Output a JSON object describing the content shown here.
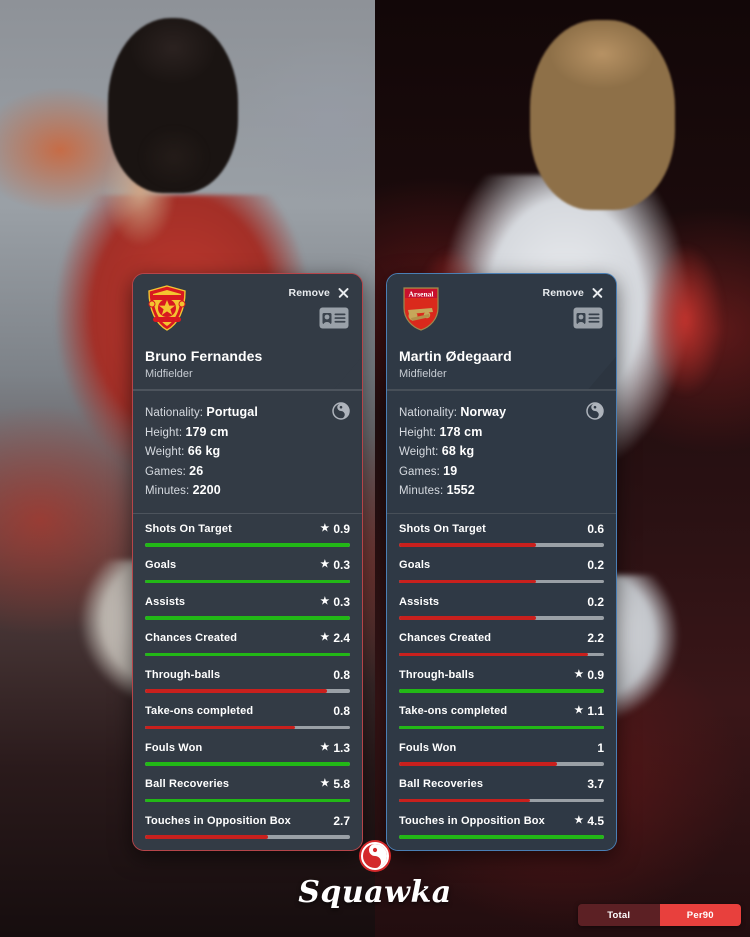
{
  "brand": {
    "name": "Squawka",
    "mark_icon": "squawka-yin-yang-icon"
  },
  "mode_toggle": {
    "options": [
      "Total",
      "Per90"
    ],
    "selected": "Per90",
    "active_color": "#e8403d",
    "inactive_color": "#5c2024"
  },
  "colors": {
    "win_bar": "#22b816",
    "lose_bar": "#c9201d",
    "track": "#9aa0a6",
    "card_bg": "#333b45",
    "left_border": "#b6454a",
    "right_border": "#4a7fb5"
  },
  "cards": [
    {
      "side": "left",
      "club": "Manchester United",
      "crest_icon": "manchester-united-crest-icon",
      "remove_label": "Remove",
      "close_icon": "close-icon",
      "idcard_icon": "player-id-card-icon",
      "name": "Bruno Fernandes",
      "position": "Midfielder",
      "info_icon": "squawka-yin-yang-icon",
      "bio": [
        {
          "label": "Nationality:",
          "value": "Portugal"
        },
        {
          "label": "Height:",
          "value": "179 cm"
        },
        {
          "label": "Weight:",
          "value": "66 kg"
        },
        {
          "label": "Games:",
          "value": "26"
        },
        {
          "label": "Minutes:",
          "value": "2200"
        }
      ],
      "stats": [
        {
          "label": "Shots On Target",
          "value": "0.9",
          "winner": true,
          "bar_pct": 100
        },
        {
          "label": "Goals",
          "value": "0.3",
          "winner": true,
          "bar_pct": 100
        },
        {
          "label": "Assists",
          "value": "0.3",
          "winner": true,
          "bar_pct": 100
        },
        {
          "label": "Chances Created",
          "value": "2.4",
          "winner": true,
          "bar_pct": 100
        },
        {
          "label": "Through-balls",
          "value": "0.8",
          "winner": false,
          "bar_pct": 89
        },
        {
          "label": "Take-ons completed",
          "value": "0.8",
          "winner": false,
          "bar_pct": 73
        },
        {
          "label": "Fouls Won",
          "value": "1.3",
          "winner": true,
          "bar_pct": 100
        },
        {
          "label": "Ball Recoveries",
          "value": "5.8",
          "winner": true,
          "bar_pct": 100
        },
        {
          "label": "Touches in Opposition Box",
          "value": "2.7",
          "winner": false,
          "bar_pct": 60
        }
      ]
    },
    {
      "side": "right",
      "club": "Arsenal",
      "crest_icon": "arsenal-crest-icon",
      "remove_label": "Remove",
      "close_icon": "close-icon",
      "idcard_icon": "player-id-card-icon",
      "name": "Martin Ødegaard",
      "position": "Midfielder",
      "info_icon": "squawka-yin-yang-icon",
      "bio": [
        {
          "label": "Nationality:",
          "value": "Norway"
        },
        {
          "label": "Height:",
          "value": "178 cm"
        },
        {
          "label": "Weight:",
          "value": "68 kg"
        },
        {
          "label": "Games:",
          "value": "19"
        },
        {
          "label": "Minutes:",
          "value": "1552"
        }
      ],
      "stats": [
        {
          "label": "Shots On Target",
          "value": "0.6",
          "winner": false,
          "bar_pct": 67
        },
        {
          "label": "Goals",
          "value": "0.2",
          "winner": false,
          "bar_pct": 67
        },
        {
          "label": "Assists",
          "value": "0.2",
          "winner": false,
          "bar_pct": 67
        },
        {
          "label": "Chances Created",
          "value": "2.2",
          "winner": false,
          "bar_pct": 92
        },
        {
          "label": "Through-balls",
          "value": "0.9",
          "winner": true,
          "bar_pct": 100
        },
        {
          "label": "Take-ons completed",
          "value": "1.1",
          "winner": true,
          "bar_pct": 100
        },
        {
          "label": "Fouls Won",
          "value": "1",
          "winner": false,
          "bar_pct": 77
        },
        {
          "label": "Ball Recoveries",
          "value": "3.7",
          "winner": false,
          "bar_pct": 64
        },
        {
          "label": "Touches in Opposition Box",
          "value": "4.5",
          "winner": true,
          "bar_pct": 100
        }
      ]
    }
  ]
}
